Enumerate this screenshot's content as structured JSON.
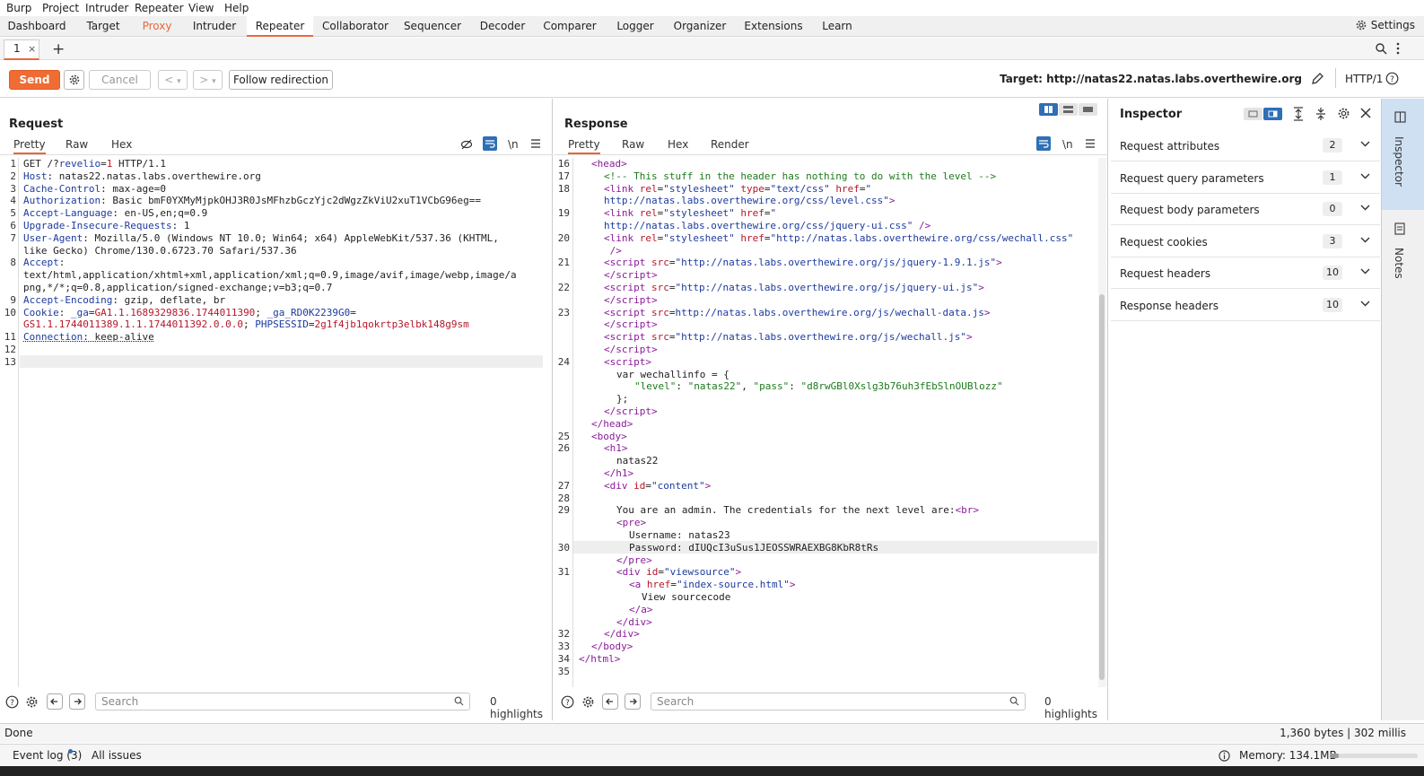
{
  "menubar": [
    "Burp",
    "Project",
    "Intruder",
    "Repeater",
    "View",
    "Help"
  ],
  "tool_tabs": [
    "Dashboard",
    "Target",
    "Proxy",
    "Intruder",
    "Repeater",
    "Collaborator",
    "Sequencer",
    "Decoder",
    "Comparer",
    "Logger",
    "Organizer",
    "Extensions",
    "Learn"
  ],
  "settings_label": "Settings",
  "repeater_tab": {
    "label": "1",
    "close": "×",
    "add": "+"
  },
  "toolbar": {
    "send": "Send",
    "cancel": "Cancel",
    "back": "<",
    "back_menu": "▾",
    "forward": ">",
    "forward_menu": "▾",
    "follow": "Follow redirection",
    "target": "Target: http://natas22.natas.labs.overthewire.org",
    "http_version": "HTTP/1"
  },
  "request": {
    "title": "Request",
    "tabs": [
      "Pretty",
      "Raw",
      "Hex"
    ],
    "wrap_toggle": "\\n",
    "search_placeholder": "Search",
    "highlights": "0 highlights"
  },
  "response": {
    "title": "Response",
    "tabs": [
      "Pretty",
      "Raw",
      "Hex",
      "Render"
    ],
    "wrap_toggle": "\\n",
    "search_placeholder": "Search",
    "highlights": "0 highlights"
  },
  "inspector": {
    "title": "Inspector",
    "sections": [
      {
        "label": "Request attributes",
        "count": "2"
      },
      {
        "label": "Request query parameters",
        "count": "1"
      },
      {
        "label": "Request body parameters",
        "count": "0"
      },
      {
        "label": "Request cookies",
        "count": "3"
      },
      {
        "label": "Request headers",
        "count": "10"
      },
      {
        "label": "Response headers",
        "count": "10"
      }
    ]
  },
  "sidebar_tabs": [
    "Inspector",
    "Notes"
  ],
  "status": {
    "left": "Done",
    "right": "1,360 bytes | 302 millis"
  },
  "footer": {
    "event_log": "Event log (3)",
    "all_issues": "All issues",
    "memory": "Memory: 134.1MB"
  }
}
